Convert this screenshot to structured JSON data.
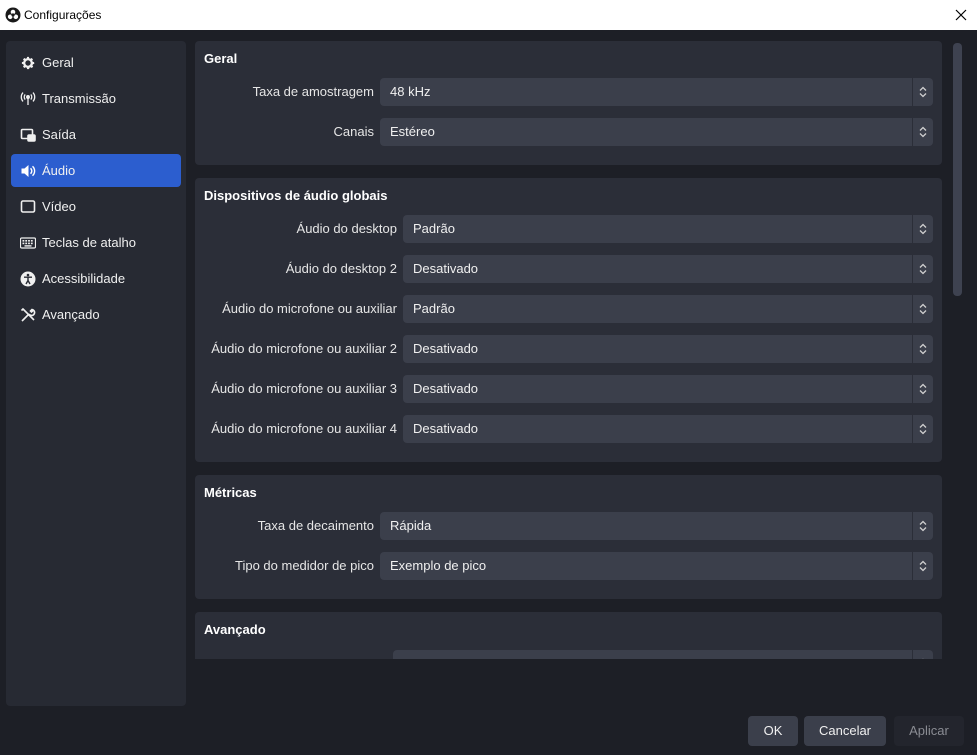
{
  "window": {
    "title": "Configurações"
  },
  "sidebar": {
    "items": [
      {
        "label": "Geral",
        "icon": "gear-icon",
        "active": false
      },
      {
        "label": "Transmissão",
        "icon": "broadcast-icon",
        "active": false
      },
      {
        "label": "Saída",
        "icon": "output-icon",
        "active": false
      },
      {
        "label": "Áudio",
        "icon": "speaker-icon",
        "active": true
      },
      {
        "label": "Vídeo",
        "icon": "monitor-icon",
        "active": false
      },
      {
        "label": "Teclas de atalho",
        "icon": "keyboard-icon",
        "active": false
      },
      {
        "label": "Acessibilidade",
        "icon": "accessibility-icon",
        "active": false
      },
      {
        "label": "Avançado",
        "icon": "tools-icon",
        "active": false
      }
    ],
    "accent_color": "#2c5ecf"
  },
  "sections": {
    "geral": {
      "title": "Geral",
      "sample_rate_label": "Taxa de amostragem",
      "sample_rate_value": "48 kHz",
      "channels_label": "Canais",
      "channels_value": "Estéreo"
    },
    "devices": {
      "title": "Dispositivos de áudio globais",
      "rows": [
        {
          "label": "Áudio do desktop",
          "value": "Padrão"
        },
        {
          "label": "Áudio do desktop 2",
          "value": "Desativado"
        },
        {
          "label": "Áudio do microfone ou auxiliar",
          "value": "Padrão"
        },
        {
          "label": "Áudio do microfone ou auxiliar 2",
          "value": "Desativado"
        },
        {
          "label": "Áudio do microfone ou auxiliar 3",
          "value": "Desativado"
        },
        {
          "label": "Áudio do microfone ou auxiliar 4",
          "value": "Desativado"
        }
      ]
    },
    "metricas": {
      "title": "Métricas",
      "decay_label": "Taxa de decaimento",
      "decay_value": "Rápida",
      "peak_label": "Tipo do medidor de pico",
      "peak_value": "Exemplo de pico"
    },
    "avancado": {
      "title": "Avançado"
    }
  },
  "buttons": {
    "ok": "OK",
    "cancel": "Cancelar",
    "apply": "Aplicar"
  }
}
